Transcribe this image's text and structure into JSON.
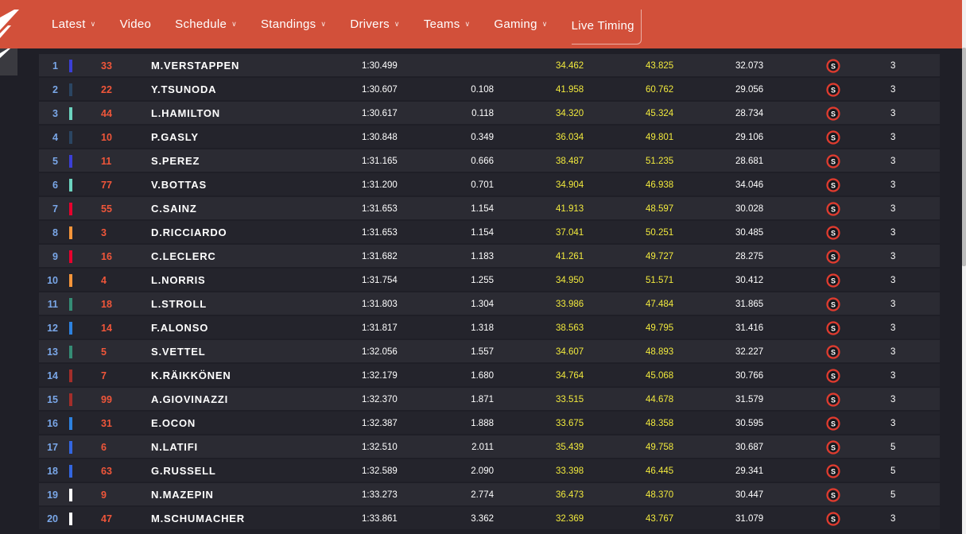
{
  "colors": {
    "header_bg": "#d2503a",
    "page_bg": "#1f1f27",
    "row_bg": "#2b2b33",
    "row_alt_bg": "#24242c",
    "position_text": "#7aa7e8",
    "number_text": "#f0563a",
    "sector_highlight": "#f2ea3d",
    "soft_tyre": "#e23b2e"
  },
  "nav": {
    "items": [
      {
        "label": "Latest",
        "chevron": true
      },
      {
        "label": "Video",
        "chevron": false
      },
      {
        "label": "Schedule",
        "chevron": true
      },
      {
        "label": "Standings",
        "chevron": true
      },
      {
        "label": "Drivers",
        "chevron": true
      },
      {
        "label": "Teams",
        "chevron": true
      },
      {
        "label": "Gaming",
        "chevron": true
      },
      {
        "label": "Live Timing",
        "chevron": false,
        "active": true
      }
    ]
  },
  "timing": {
    "tyre_icon": "soft-tyre-icon",
    "tyre_letter": "S",
    "rows": [
      {
        "pos": "1",
        "num": "33",
        "name": "M.VERSTAPPEN",
        "time": "1:30.499",
        "gap": "",
        "s1": "34.462",
        "s2": "43.825",
        "s3": "32.073",
        "laps": "3",
        "team_color": "#3b3fd6"
      },
      {
        "pos": "2",
        "num": "22",
        "name": "Y.TSUNODA",
        "time": "1:30.607",
        "gap": "0.108",
        "s1": "41.958",
        "s2": "60.762",
        "s3": "29.056",
        "laps": "3",
        "team_color": "#2b4562"
      },
      {
        "pos": "3",
        "num": "44",
        "name": "L.HAMILTON",
        "time": "1:30.617",
        "gap": "0.118",
        "s1": "34.320",
        "s2": "45.324",
        "s3": "28.734",
        "laps": "3",
        "team_color": "#6cd3bf"
      },
      {
        "pos": "4",
        "num": "10",
        "name": "P.GASLY",
        "time": "1:30.848",
        "gap": "0.349",
        "s1": "36.034",
        "s2": "49.801",
        "s3": "29.106",
        "laps": "3",
        "team_color": "#2b4562"
      },
      {
        "pos": "5",
        "num": "11",
        "name": "S.PEREZ",
        "time": "1:31.165",
        "gap": "0.666",
        "s1": "38.487",
        "s2": "51.235",
        "s3": "28.681",
        "laps": "3",
        "team_color": "#3b3fd6"
      },
      {
        "pos": "6",
        "num": "77",
        "name": "V.BOTTAS",
        "time": "1:31.200",
        "gap": "0.701",
        "s1": "34.904",
        "s2": "46.938",
        "s3": "34.046",
        "laps": "3",
        "team_color": "#6cd3bf"
      },
      {
        "pos": "7",
        "num": "55",
        "name": "C.SAINZ",
        "time": "1:31.653",
        "gap": "1.154",
        "s1": "41.913",
        "s2": "48.597",
        "s3": "30.028",
        "laps": "3",
        "team_color": "#e8002d"
      },
      {
        "pos": "8",
        "num": "3",
        "name": "D.RICCIARDO",
        "time": "1:31.653",
        "gap": "1.154",
        "s1": "37.041",
        "s2": "50.251",
        "s3": "30.485",
        "laps": "3",
        "team_color": "#f5953a"
      },
      {
        "pos": "9",
        "num": "16",
        "name": "C.LECLERC",
        "time": "1:31.682",
        "gap": "1.183",
        "s1": "41.261",
        "s2": "49.727",
        "s3": "28.275",
        "laps": "3",
        "team_color": "#e8002d"
      },
      {
        "pos": "10",
        "num": "4",
        "name": "L.NORRIS",
        "time": "1:31.754",
        "gap": "1.255",
        "s1": "34.950",
        "s2": "51.571",
        "s3": "30.412",
        "laps": "3",
        "team_color": "#f5953a"
      },
      {
        "pos": "11",
        "num": "18",
        "name": "L.STROLL",
        "time": "1:31.803",
        "gap": "1.304",
        "s1": "33.986",
        "s2": "47.484",
        "s3": "31.865",
        "laps": "3",
        "team_color": "#358c75"
      },
      {
        "pos": "12",
        "num": "14",
        "name": "F.ALONSO",
        "time": "1:31.817",
        "gap": "1.318",
        "s1": "38.563",
        "s2": "49.795",
        "s3": "31.416",
        "laps": "3",
        "team_color": "#2d82e0"
      },
      {
        "pos": "13",
        "num": "5",
        "name": "S.VETTEL",
        "time": "1:32.056",
        "gap": "1.557",
        "s1": "34.607",
        "s2": "48.893",
        "s3": "32.227",
        "laps": "3",
        "team_color": "#358c75"
      },
      {
        "pos": "14",
        "num": "7",
        "name": "K.RÄIKKÖNEN",
        "time": "1:32.179",
        "gap": "1.680",
        "s1": "34.764",
        "s2": "45.068",
        "s3": "30.766",
        "laps": "3",
        "team_color": "#a32e2a"
      },
      {
        "pos": "15",
        "num": "99",
        "name": "A.GIOVINAZZI",
        "time": "1:32.370",
        "gap": "1.871",
        "s1": "33.515",
        "s2": "44.678",
        "s3": "31.579",
        "laps": "3",
        "team_color": "#a32e2a"
      },
      {
        "pos": "16",
        "num": "31",
        "name": "E.OCON",
        "time": "1:32.387",
        "gap": "1.888",
        "s1": "33.675",
        "s2": "48.358",
        "s3": "30.595",
        "laps": "3",
        "team_color": "#2d82e0"
      },
      {
        "pos": "17",
        "num": "6",
        "name": "N.LATIFI",
        "time": "1:32.510",
        "gap": "2.011",
        "s1": "35.439",
        "s2": "49.758",
        "s3": "30.687",
        "laps": "5",
        "team_color": "#3366e0"
      },
      {
        "pos": "18",
        "num": "63",
        "name": "G.RUSSELL",
        "time": "1:32.589",
        "gap": "2.090",
        "s1": "33.398",
        "s2": "46.445",
        "s3": "29.341",
        "laps": "5",
        "team_color": "#3366e0"
      },
      {
        "pos": "19",
        "num": "9",
        "name": "N.MAZEPIN",
        "time": "1:33.273",
        "gap": "2.774",
        "s1": "36.473",
        "s2": "48.370",
        "s3": "30.447",
        "laps": "5",
        "team_color": "#ffffff"
      },
      {
        "pos": "20",
        "num": "47",
        "name": "M.SCHUMACHER",
        "time": "1:33.861",
        "gap": "3.362",
        "s1": "32.369",
        "s2": "43.767",
        "s3": "31.079",
        "laps": "3",
        "team_color": "#ffffff"
      }
    ]
  }
}
